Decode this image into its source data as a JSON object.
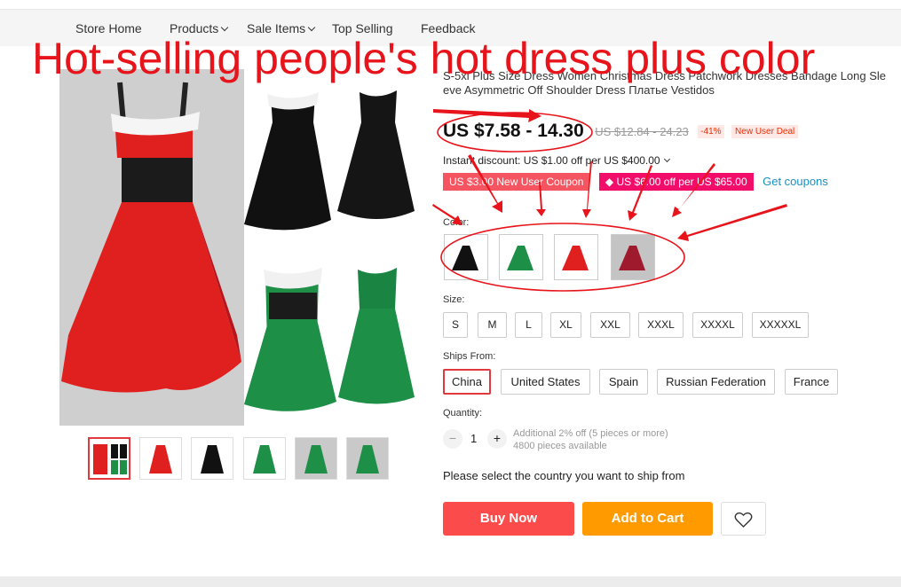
{
  "nav": {
    "items": [
      "Store Home",
      "Products",
      "Sale Items",
      "Top Selling",
      "Feedback"
    ]
  },
  "overlay_title": "Hot-selling people's hot dress plus color",
  "product": {
    "title_line1": "S-5xl Plus Size Dress Women Christmas Dress Patchwork Dresses Bandage Long Sle",
    "title_line2": "eve Asymmetric Off Shoulder Dress Платье Vestidos",
    "price": "US $7.58 - 14.30",
    "original_price": "US $12.84 - 24.23",
    "discount_pct": "-41%",
    "deal_badge": "New User Deal",
    "instant_discount": "Instant discount: US $1.00 off per US $400.00",
    "coupons": [
      "US $3.00 New User Coupon",
      "US $6.00 off per US $65.00"
    ],
    "get_coupons": "Get coupons"
  },
  "options": {
    "color_label": "Color:",
    "size_label": "Size:",
    "sizes": [
      "S",
      "M",
      "L",
      "XL",
      "XXL",
      "XXXL",
      "XXXXL",
      "XXXXXL"
    ],
    "ships_label": "Ships From:",
    "ships_from": [
      "China",
      "United States",
      "Spain",
      "Russian Federation",
      "France"
    ],
    "ships_selected": "China"
  },
  "quantity": {
    "label": "Quantity:",
    "minus": "−",
    "value": "1",
    "plus": "+",
    "note1": "Additional 2% off (5 pieces or more)",
    "note2": "4800 pieces available"
  },
  "ship_message": "Please select the country you want to ship from",
  "buttons": {
    "buy": "Buy Now",
    "cart": "Add to Cart"
  },
  "colors": {
    "red_dress": "#e0201f",
    "black_dress": "#111111",
    "green_dress": "#1e8f47",
    "wine_dress": "#9e1a2c",
    "annotation": "#e8141b"
  }
}
